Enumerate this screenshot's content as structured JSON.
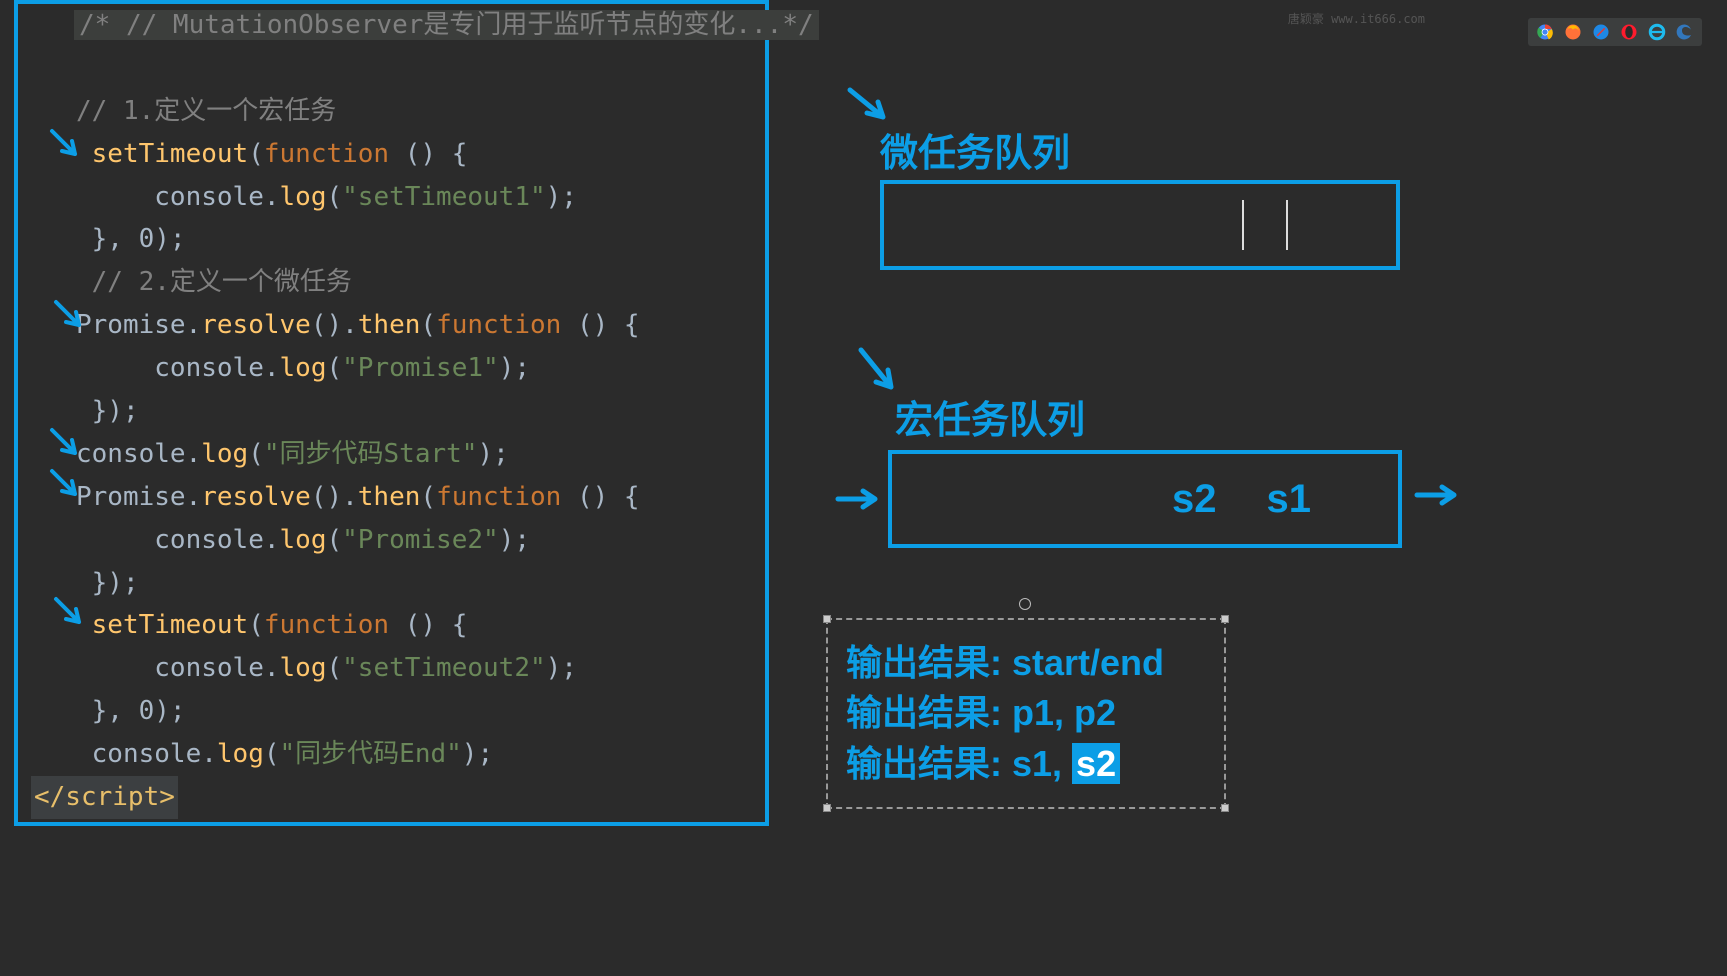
{
  "watermark": "唐颖豪 www.it666.com",
  "code": {
    "comment_top": "/* // MutationObserver是专门用于监听节点的变化...*/",
    "c1": "// 1.定义一个宏任务",
    "set_timeout": "setTimeout",
    "function_kw": "function",
    "console": "console",
    "log": "log",
    "str_st1": "\"setTimeout1\"",
    "delay0_a": "0",
    "c2": "// 2.定义一个微任务",
    "promise": "Promise",
    "resolve": "resolve",
    "then": "then",
    "str_p1": "\"Promise1\"",
    "str_start": "\"同步代码Start\"",
    "str_p2": "\"Promise2\"",
    "str_st2": "\"setTimeout2\"",
    "delay0_b": "0",
    "str_end": "\"同步代码End\"",
    "script_close": "</script>"
  },
  "micro_queue": {
    "label": "微任务队列",
    "items": []
  },
  "macro_queue": {
    "label": "宏任务队列",
    "items": [
      "s2",
      "s1"
    ]
  },
  "output": {
    "line1": "输出结果: start/end",
    "line2": "输出结果: p1, p2",
    "line3_prefix": "输出结果: s1, ",
    "line3_highlight": "s2"
  }
}
